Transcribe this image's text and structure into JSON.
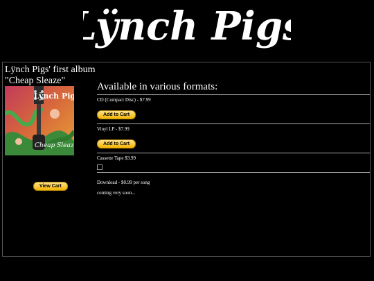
{
  "logo": {
    "text": "Lÿnch Pigs"
  },
  "album": {
    "title_line1": "Lÿnch Pigs' first album",
    "title_line2": "\"Cheap Sleaze\"",
    "cover_text_top": "Lÿnch Pigs",
    "cover_text_bottom": "Cheap Sleaze"
  },
  "cart": {
    "view_label": "View Cart"
  },
  "formats": {
    "heading": "Available in various formats:",
    "items": [
      {
        "label": "CD (Compact Disc) - $7.99",
        "button": "Add to Cart"
      },
      {
        "label": "Vinyl LP - $7.99",
        "button": "Add to Cart"
      },
      {
        "label": "Cassette Tape $3.99"
      },
      {
        "label": "Download - $0.99 per song",
        "note": "coming very soon..."
      }
    ]
  },
  "colors": {
    "background": "#000000",
    "text": "#ffffff",
    "button": "#f4b400"
  }
}
